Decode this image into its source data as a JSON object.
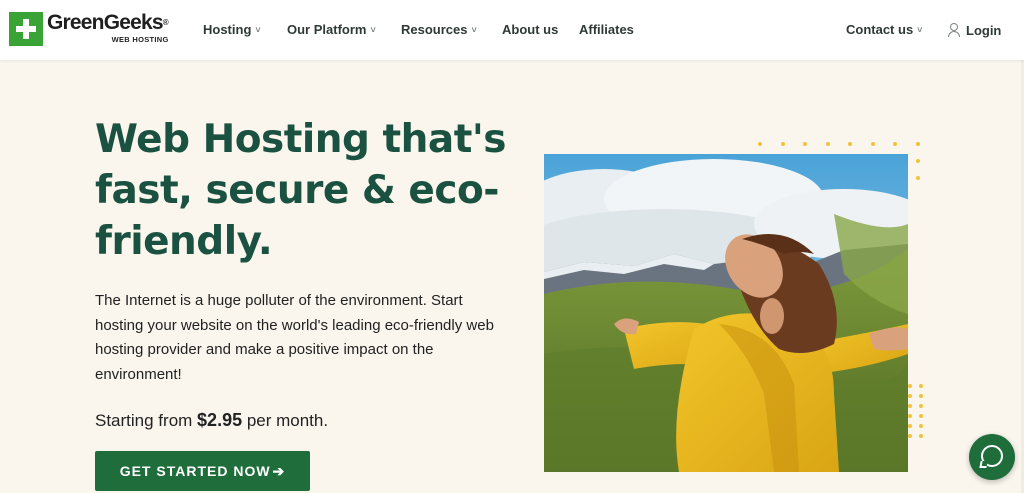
{
  "brand": {
    "name": "GreenGeeks",
    "trademark": "®",
    "tagline": "WEB HOSTING",
    "accent": "#3aa335"
  },
  "nav": {
    "items": [
      {
        "label": "Hosting",
        "has_menu": true
      },
      {
        "label": "Our Platform",
        "has_menu": true
      },
      {
        "label": "Resources",
        "has_menu": true
      },
      {
        "label": "About us",
        "has_menu": false
      },
      {
        "label": "Affiliates",
        "has_menu": false
      }
    ],
    "contact": {
      "label": "Contact us",
      "has_menu": true
    },
    "login": {
      "label": "Login",
      "icon": "user-icon"
    },
    "chevron": "˅"
  },
  "hero": {
    "title": "Web Hosting that's fast, secure & eco-friendly.",
    "body": "The Internet is a huge polluter of the environment. Start hosting your website on the world's leading eco-friendly web hosting provider and make a positive impact on the environment!",
    "price_prefix": "Starting from ",
    "price_value": "$2.95",
    "price_suffix": " per month.",
    "cta_label": "GET STARTED NOW",
    "cta_arrow": "➔",
    "heading_color": "#1a5140",
    "cta_color": "#1e6d3a"
  },
  "decor": {
    "dot_color": "#f2c23c",
    "photo_alt": "Woman in yellow jacket with arms outstretched on a green hillside"
  },
  "chat": {
    "icon": "chat-icon"
  }
}
